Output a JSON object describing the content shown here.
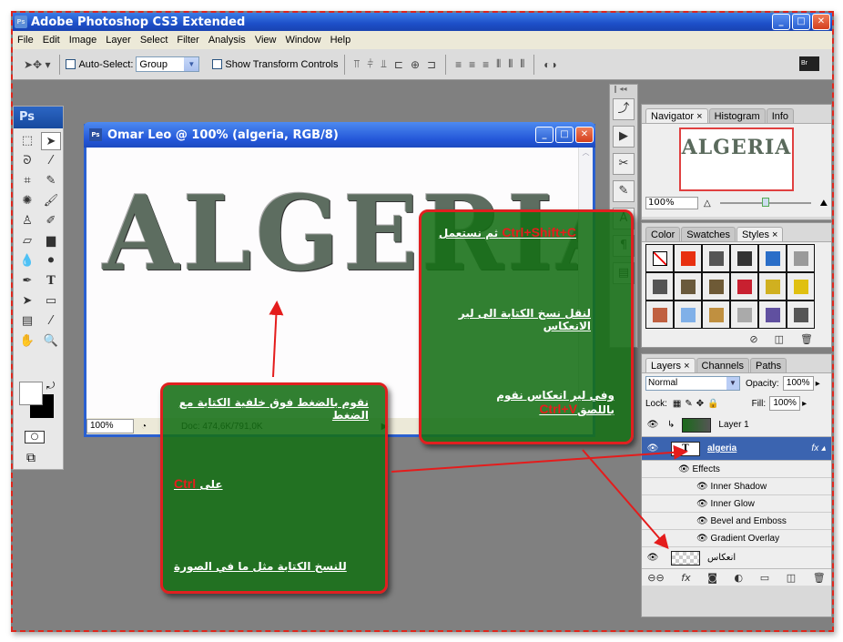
{
  "app": {
    "title": "Adobe Photoshop CS3 Extended",
    "icon": "ps-app-icon",
    "window_controls": [
      "minimize",
      "maximize",
      "close"
    ]
  },
  "menu": [
    "File",
    "Edit",
    "Image",
    "Layer",
    "Select",
    "Filter",
    "Analysis",
    "View",
    "Window",
    "Help"
  ],
  "options_bar": {
    "auto_select_label": "Auto-Select:",
    "auto_select_checked": false,
    "auto_select_value": "Group",
    "show_transform_label": "Show Transform Controls",
    "show_transform_checked": false,
    "bridge_label": "Br"
  },
  "toolbox": {
    "logo": "Ps",
    "tools": [
      "marquee",
      "move",
      "lasso",
      "magic-wand",
      "crop",
      "slice",
      "healing-brush",
      "brush",
      "clone-stamp",
      "history-brush",
      "eraser",
      "gradient",
      "blur",
      "dodge",
      "pen",
      "type",
      "path-selection",
      "rectangle",
      "notes",
      "eyedropper",
      "hand",
      "zoom"
    ],
    "active_tool": "move"
  },
  "document": {
    "title": "Omar Leo @ 100% (algeria, RGB/8)",
    "canvas_text": "ALGERIA",
    "zoom": "100%",
    "doc_info": "Doc: 474,6K/791,0K"
  },
  "navigator": {
    "tabs": [
      "Navigator",
      "Histogram",
      "Info"
    ],
    "active_tab": "Navigator",
    "thumb_text": "ALGERIA",
    "zoom": "100%",
    "zoom_slider_fraction": 0.5
  },
  "styles_panel": {
    "tabs": [
      "Color",
      "Swatches",
      "Styles"
    ],
    "active_tab": "Styles",
    "swatch_colors": [
      "none",
      "#e83010",
      "#555555",
      "#333333",
      "#2a6ec8",
      "#9a9a9a",
      "#555555",
      "#6a5a3c",
      "#6e5a36",
      "#c82030",
      "#d0b020",
      "#e0c010",
      "#c06040",
      "#80b0e8",
      "#c09040",
      "#aaaaaa",
      "#6050a0",
      "#555555"
    ]
  },
  "layers_panel": {
    "tabs": [
      "Layers",
      "Channels",
      "Paths"
    ],
    "active_tab": "Layers",
    "blend_mode": "Normal",
    "opacity_label": "Opacity:",
    "opacity": "100%",
    "lock_label": "Lock:",
    "fill_label": "Fill:",
    "fill": "100%",
    "layers": [
      {
        "name": "Layer 1",
        "type": "image",
        "visible": true,
        "selected": false
      },
      {
        "name": "algeria",
        "type": "text",
        "visible": true,
        "selected": true,
        "has_fx": true
      }
    ],
    "effects_label": "Effects",
    "effects": [
      "Inner Shadow",
      "Inner Glow",
      "Bevel and Emboss",
      "Gradient Overlay"
    ],
    "bottom_layer": {
      "name": "انعكاس",
      "visible": true
    }
  },
  "callout_left": {
    "line1": "نقوم بالضغط فوق خلفية الكتابة مع الضغط",
    "line2_prefix": "على",
    "line2_key": "Ctrl",
    "line3": "للنسخ الكتابة مثل ما في الصورة"
  },
  "callout_right": {
    "line1_text": "ثم نستعمل",
    "line1_key": "Ctrl+Shift+C",
    "line2": "لنقل نسخ الكتابة الى لير الانعكاس",
    "line3_text": "وفي لير انعكاس نقوم باللصق",
    "line3_key": "Ctrl+V"
  },
  "colors": {
    "callout_bg": "#1e7a1e",
    "callout_border": "#e02020",
    "key_text": "#e81c1c",
    "selection": "#3b64b0",
    "xp_title": "#2356d8"
  }
}
